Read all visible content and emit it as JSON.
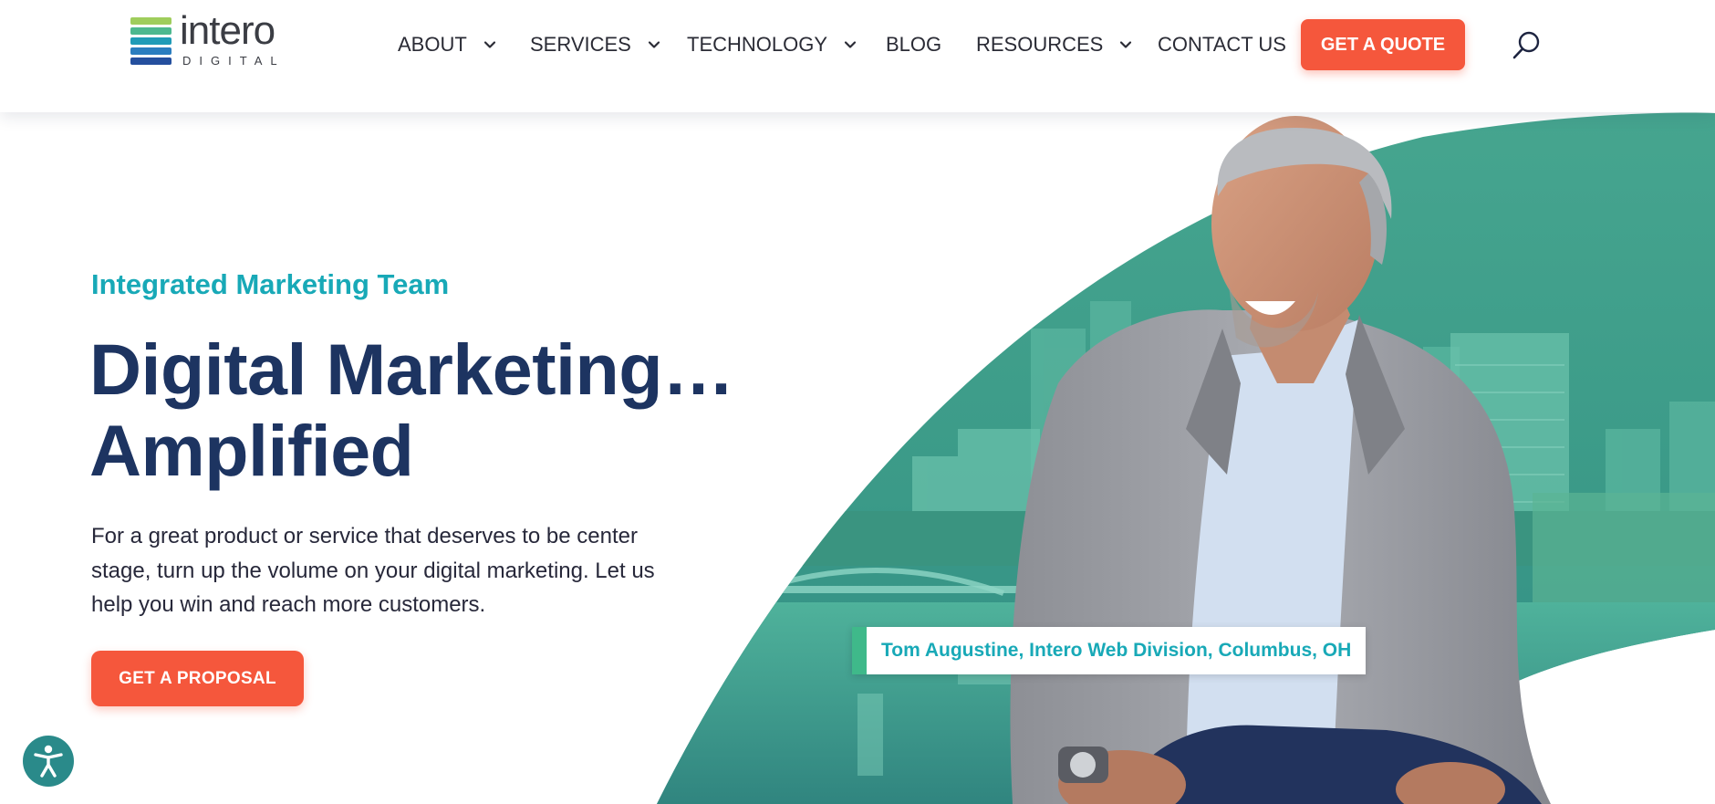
{
  "brand": {
    "logo_word": "intero",
    "logo_sub": "DIGITAL",
    "logo_bar_colors": [
      "#9fcd5c",
      "#4cb88f",
      "#1f9bb7",
      "#2a7dbf",
      "#244f9e"
    ]
  },
  "nav": {
    "items": [
      {
        "label": "ABOUT",
        "has_dropdown": true
      },
      {
        "label": "SERVICES",
        "has_dropdown": true
      },
      {
        "label": "TECHNOLOGY",
        "has_dropdown": true
      },
      {
        "label": "BLOG",
        "has_dropdown": false
      },
      {
        "label": "RESOURCES",
        "has_dropdown": true
      },
      {
        "label": "CONTACT US",
        "has_dropdown": false
      }
    ],
    "cta_label": "GET A QUOTE",
    "search_icon": "search-icon"
  },
  "hero": {
    "eyebrow": "Integrated Marketing Team",
    "headline_line1": "Digital Marketing…",
    "headline_line2": "Amplified",
    "intro": "For a great product or service that deserves to be center stage, turn up the volume on your digital marketing. Let us help you win and reach more customers.",
    "cta_label": "GET A PROPOSAL",
    "photo_caption": "Tom Augustine, Intero Web Division, Columbus, OH"
  },
  "accessibility": {
    "icon": "accessibility-icon"
  },
  "colors": {
    "accent_orange": "#f5573c",
    "teal_text": "#18a9b7",
    "navy_heading": "#1d3461",
    "hero_green": "#3d9e8c"
  }
}
